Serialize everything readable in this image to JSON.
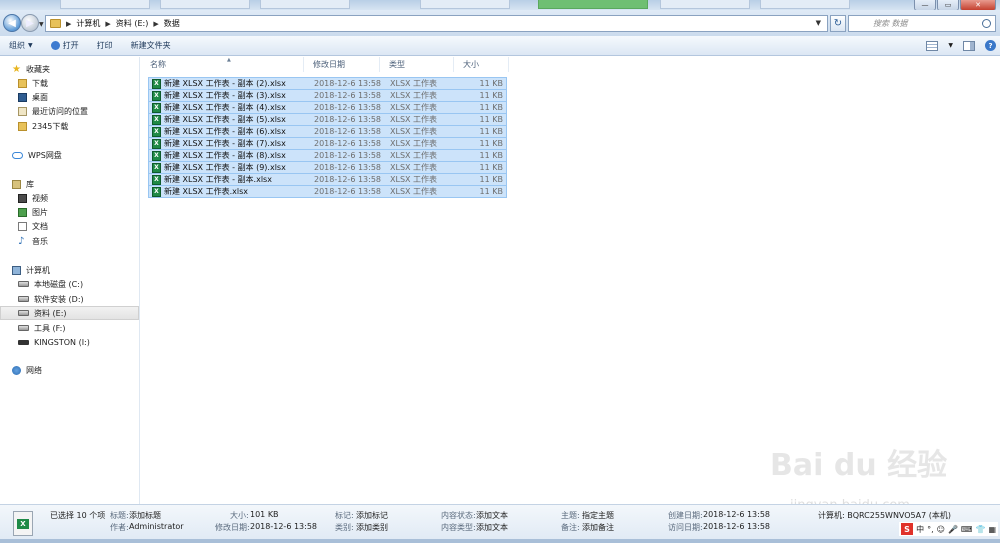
{
  "window": {
    "min_glyph": "—",
    "max_glyph": "▭",
    "close_glyph": "✕"
  },
  "address": {
    "crumbs": [
      "计算机",
      "资料 (E:)",
      "数据"
    ]
  },
  "search": {
    "placeholder": "搜索 数据"
  },
  "toolbar": {
    "organize": "组织",
    "open": "打开",
    "print": "打印",
    "new_folder": "新建文件夹"
  },
  "nav": {
    "favorites": "收藏夹",
    "downloads": "下载",
    "desktop": "桌面",
    "recent": "最近访问的位置",
    "download2345": "2345下载",
    "wps": "WPS网盘",
    "libraries": "库",
    "videos": "视频",
    "pictures": "图片",
    "documents": "文档",
    "music": "音乐",
    "computer": "计算机",
    "drive_c": "本地磁盘 (C:)",
    "drive_d": "软件安装 (D:)",
    "drive_e": "资料 (E:)",
    "drive_f": "工具 (F:)",
    "drive_i": "KINGSTON (I:)",
    "network": "网络"
  },
  "columns": {
    "name": "名称",
    "modified": "修改日期",
    "type": "类型",
    "size": "大小"
  },
  "files": [
    {
      "name": "新建 XLSX 工作表 - 副本 (2).xlsx",
      "date": "2018-12-6 13:58",
      "type": "XLSX 工作表",
      "size": "11 KB"
    },
    {
      "name": "新建 XLSX 工作表 - 副本 (3).xlsx",
      "date": "2018-12-6 13:58",
      "type": "XLSX 工作表",
      "size": "11 KB"
    },
    {
      "name": "新建 XLSX 工作表 - 副本 (4).xlsx",
      "date": "2018-12-6 13:58",
      "type": "XLSX 工作表",
      "size": "11 KB"
    },
    {
      "name": "新建 XLSX 工作表 - 副本 (5).xlsx",
      "date": "2018-12-6 13:58",
      "type": "XLSX 工作表",
      "size": "11 KB"
    },
    {
      "name": "新建 XLSX 工作表 - 副本 (6).xlsx",
      "date": "2018-12-6 13:58",
      "type": "XLSX 工作表",
      "size": "11 KB"
    },
    {
      "name": "新建 XLSX 工作表 - 副本 (7).xlsx",
      "date": "2018-12-6 13:58",
      "type": "XLSX 工作表",
      "size": "11 KB"
    },
    {
      "name": "新建 XLSX 工作表 - 副本 (8).xlsx",
      "date": "2018-12-6 13:58",
      "type": "XLSX 工作表",
      "size": "11 KB"
    },
    {
      "name": "新建 XLSX 工作表 - 副本 (9).xlsx",
      "date": "2018-12-6 13:58",
      "type": "XLSX 工作表",
      "size": "11 KB"
    },
    {
      "name": "新建 XLSX 工作表 - 副本.xlsx",
      "date": "2018-12-6 13:58",
      "type": "XLSX 工作表",
      "size": "11 KB"
    },
    {
      "name": "新建 XLSX 工作表.xlsx",
      "date": "2018-12-6 13:58",
      "type": "XLSX 工作表",
      "size": "11 KB"
    }
  ],
  "details": {
    "selected_count": "已选择 10 个项",
    "title_label": "标题:",
    "title_value": "添加标题",
    "author_label": "作者:",
    "author_value": "Administrator",
    "size_label": "大小:",
    "size_value": "101 KB",
    "modified_label": "修改日期:",
    "modified_value": "2018-12-6 13:58",
    "tags_label": "标记:",
    "tags_value": "添加标记",
    "category_label": "类别:",
    "category_value": "添加类别",
    "content_status_label": "内容状态:",
    "content_status_value": "添加文本",
    "content_type_label": "内容类型:",
    "content_type_value": "添加文本",
    "subject_label": "主题:",
    "subject_value": "指定主题",
    "comments_label": "备注:",
    "comments_value": "添加备注",
    "created_label": "创建日期:",
    "created_value": "2018-12-6 13:58",
    "accessed_label": "访问日期:",
    "accessed_value": "2018-12-6 13:58",
    "computer_value": "计算机: BQRC255WNVO5A7 (本机)"
  },
  "tray": {
    "ime": "S",
    "lang": "中",
    "punct": "°,"
  },
  "watermark": {
    "brand": "Bai du 经验",
    "url": "jingyan.baidu.com"
  }
}
